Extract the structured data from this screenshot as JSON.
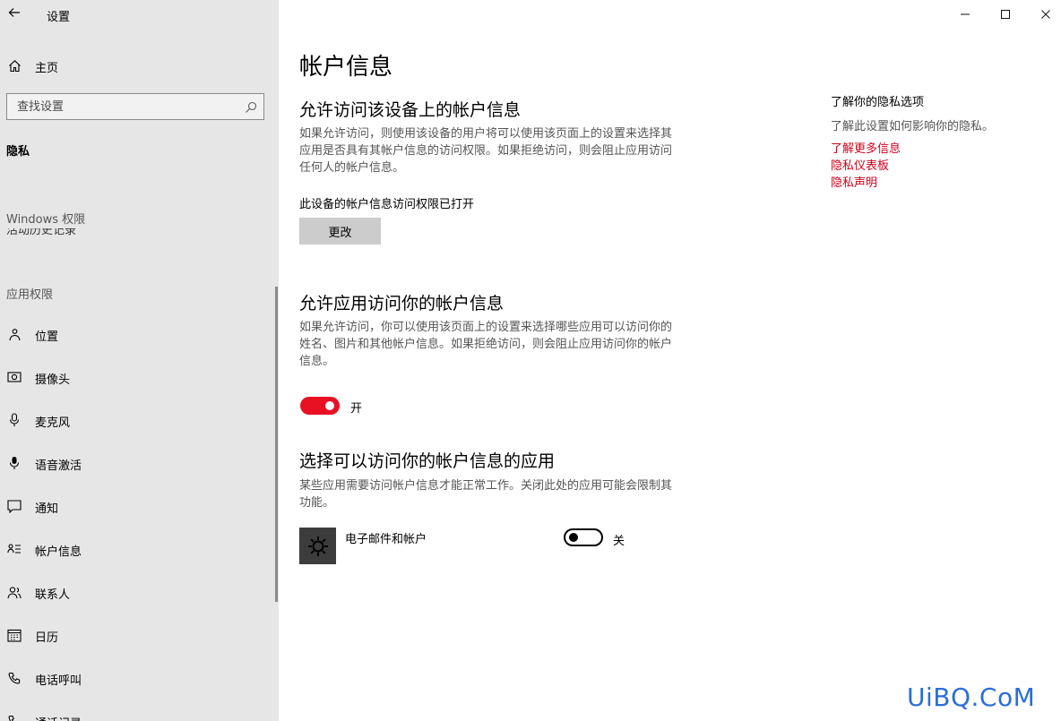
{
  "window": {
    "title": "设置",
    "controls": [
      "minimize",
      "maximize",
      "close"
    ]
  },
  "sidebar": {
    "home_label": "主页",
    "search_placeholder": "查找设置",
    "section_title": "隐私",
    "groups": {
      "windows_permissions": "Windows 权限",
      "clipped_item": "活动历史记录",
      "app_permissions": "应用权限"
    },
    "items": [
      {
        "label": "位置",
        "icon": "location-icon"
      },
      {
        "label": "摄像头",
        "icon": "camera-icon"
      },
      {
        "label": "麦克风",
        "icon": "microphone-icon"
      },
      {
        "label": "语音激活",
        "icon": "voice-activation-icon"
      },
      {
        "label": "通知",
        "icon": "notification-icon"
      },
      {
        "label": "帐户信息",
        "icon": "account-info-icon"
      },
      {
        "label": "联系人",
        "icon": "contacts-icon"
      },
      {
        "label": "日历",
        "icon": "calendar-icon"
      },
      {
        "label": "电话呼叫",
        "icon": "phone-icon"
      },
      {
        "label": "通话记录",
        "icon": "call-history-icon"
      }
    ]
  },
  "main": {
    "page_title": "帐户信息",
    "section1": {
      "heading": "允许访问该设备上的帐户信息",
      "description": [
        "如果允许访问，则使用该设备的用户将可以使用该页面上的设置来选择其",
        "应用是否具有其帐户信息的访问权限。如果拒绝访问，则会阻止应用访问",
        "任何人的帐户信息。"
      ],
      "status": "此设备的帐户信息访问权限已打开",
      "button": "更改"
    },
    "section2": {
      "heading": "允许应用访问你的帐户信息",
      "description": [
        "如果允许访问，你可以使用该页面上的设置来选择哪些应用可以访问你的",
        "姓名、图片和其他帐户信息。如果拒绝访问，则会阻止应用访问你的帐户",
        "信息。"
      ],
      "toggle_state": "开"
    },
    "section3": {
      "heading": "选择可以访问你的帐户信息的应用",
      "description": [
        "某些应用需要访问帐户信息才能正常工作。关闭此处的应用可能会限制其",
        "功能。"
      ],
      "apps": [
        {
          "name": "电子邮件和帐户",
          "icon": "gear-icon",
          "toggle_state": "关"
        }
      ]
    }
  },
  "right_column": {
    "title": "了解你的隐私选项",
    "text": "了解此设置如何影响你的隐私。",
    "links": [
      "了解更多信息",
      "隐私仪表板",
      "隐私声明"
    ]
  },
  "colors": {
    "accent": "#e81123",
    "link": "#d0021b",
    "sidebar_bg": "#e6e6e6"
  },
  "watermark": "UiBQ.CoM"
}
